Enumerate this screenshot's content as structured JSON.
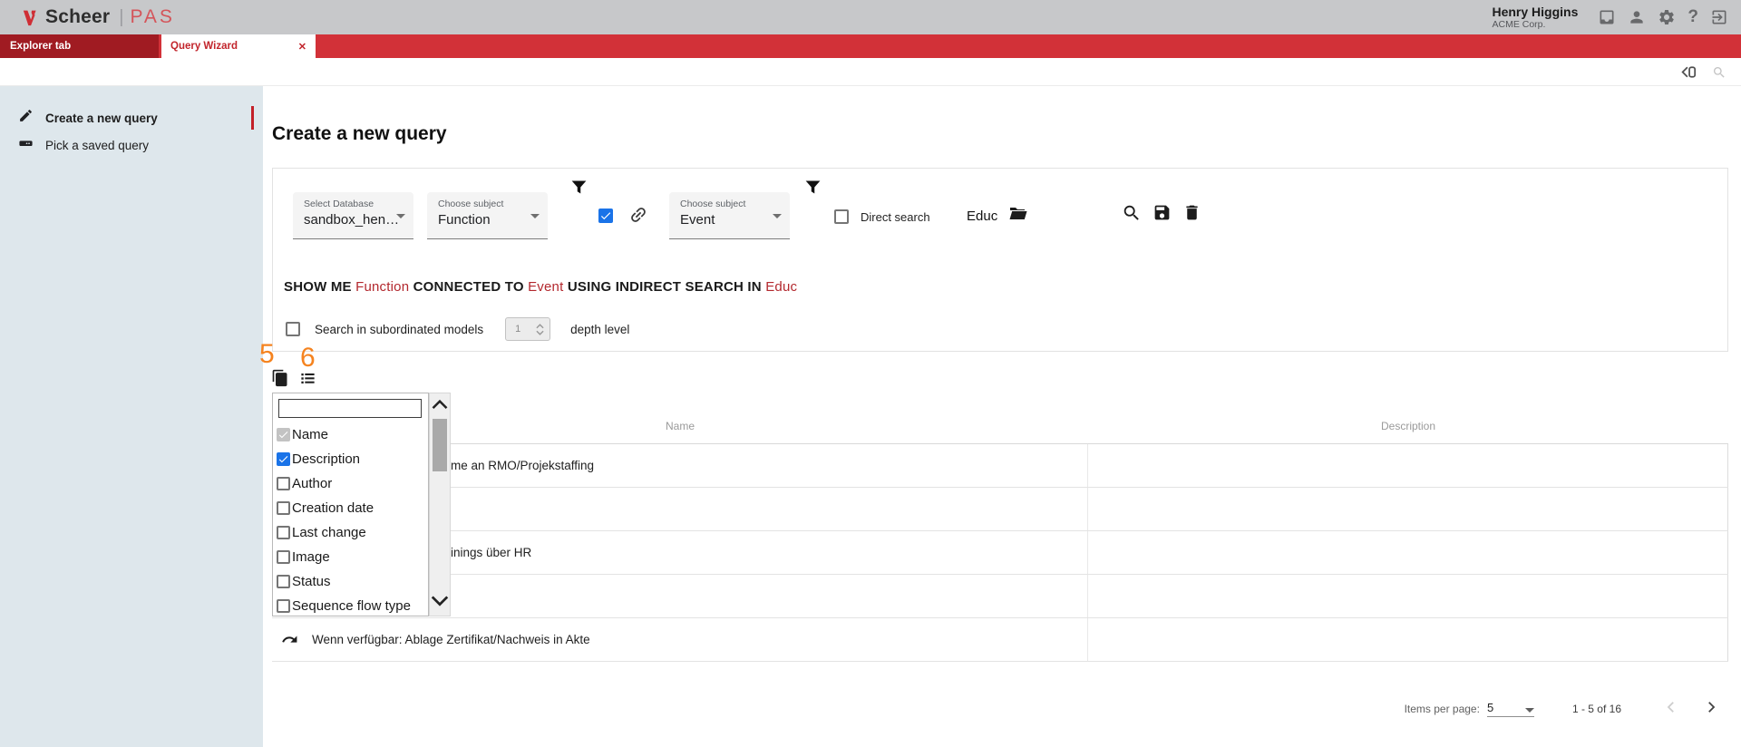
{
  "header": {
    "brand": "Scheer",
    "brand_divider": "|",
    "product": "PAS",
    "user_name": "Henry Higgins",
    "user_company": "ACME Corp."
  },
  "tabbar": {
    "tabs": [
      {
        "label": "Explorer tab",
        "active": false
      },
      {
        "label": "Query Wizard",
        "active": true
      }
    ],
    "close_glyph": "✕"
  },
  "sidebar": {
    "items": [
      {
        "label": "Create a new query",
        "selected": true
      },
      {
        "label": "Pick a saved query",
        "selected": false
      }
    ]
  },
  "main": {
    "title": "Create a new query",
    "builder": {
      "database_select": {
        "label": "Select Database",
        "value": "sandbox_hen…"
      },
      "subject_select_1": {
        "label": "Choose subject",
        "value": "Function"
      },
      "subject_select_2": {
        "label": "Choose subject",
        "value": "Event"
      },
      "connection_checkbox_checked": true,
      "direct_search": {
        "label": "Direct search",
        "checked": false
      },
      "group_value": "Educ",
      "sentence_parts": [
        {
          "text": "SHOW ME",
          "style": "strong"
        },
        {
          "text": "Function",
          "style": "red"
        },
        {
          "text": "CONNECTED TO",
          "style": "strong"
        },
        {
          "text": "Event",
          "style": "red"
        },
        {
          "text": "USING INDIRECT SEARCH IN",
          "style": "strong"
        },
        {
          "text": "Educ",
          "style": "red"
        }
      ],
      "subordinated": {
        "checked": false,
        "label": "Search in subordinated models",
        "depth_value": "1",
        "depth_suffix": "depth level"
      }
    },
    "annotations": [
      {
        "text": "5"
      },
      {
        "text": "6"
      }
    ],
    "column_chooser": {
      "filter_value": "",
      "options": [
        {
          "label": "Name",
          "checked": true,
          "disabled": true
        },
        {
          "label": "Description",
          "checked": true,
          "disabled": false
        },
        {
          "label": "Author",
          "checked": false,
          "disabled": false
        },
        {
          "label": "Creation date",
          "checked": false,
          "disabled": false
        },
        {
          "label": "Last change",
          "checked": false,
          "disabled": false
        },
        {
          "label": "Image",
          "checked": false,
          "disabled": false
        },
        {
          "label": "Status",
          "checked": false,
          "disabled": false
        },
        {
          "label": "Sequence flow type",
          "checked": false,
          "disabled": false
        }
      ]
    },
    "table": {
      "columns": [
        "Name",
        "Description"
      ],
      "rows": [
        {
          "name": "me an RMO/Projekstaffing",
          "description": "",
          "clipped": true,
          "icon": false
        },
        {
          "name": "",
          "description": "",
          "clipped": false,
          "icon": false
        },
        {
          "name": "inings über HR",
          "description": "",
          "clipped": true,
          "icon": false
        },
        {
          "name": "",
          "description": "",
          "clipped": false,
          "icon": false
        },
        {
          "name": "Wenn verfügbar: Ablage Zertifikat/Nachweis in Akte",
          "description": "",
          "clipped": false,
          "icon": true
        }
      ]
    },
    "pagination": {
      "items_per_page_label": "Items per page:",
      "items_per_page_value": "5",
      "range_label": "1 - 5 of 16"
    }
  },
  "colors": {
    "header_bg": "#c7c8ca",
    "tab_bar": "#d23138",
    "tab_dark": "#a01b22",
    "sidebar_bg": "#dee7ec",
    "accent_red": "#b3282e",
    "checkbox_blue": "#1a73e8",
    "annotation_orange": "#f5831f"
  }
}
